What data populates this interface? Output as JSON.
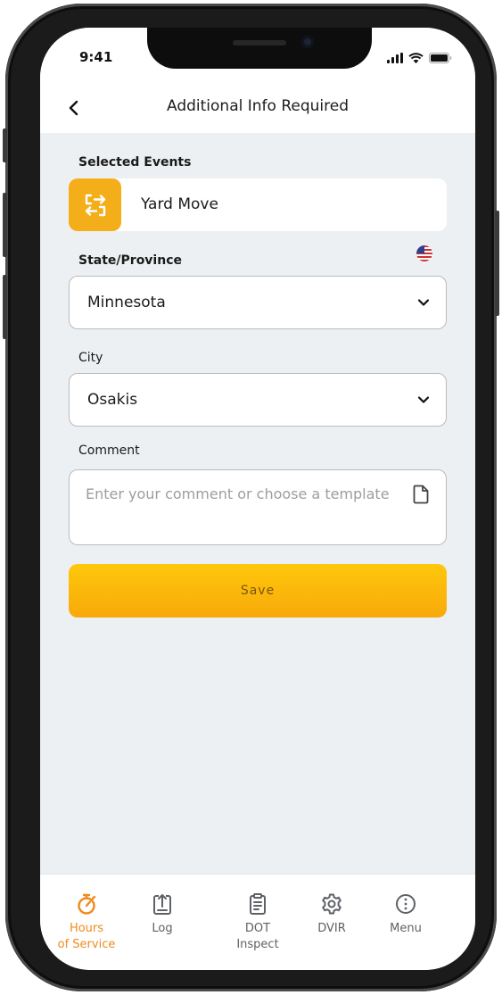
{
  "status_bar": {
    "time": "9:41"
  },
  "header": {
    "title": "Additional Info Required"
  },
  "form": {
    "selected_events_label": "Selected Events",
    "event_name": "Yard Move",
    "state_label": "State/Province",
    "state_value": "Minnesota",
    "city_label": "City",
    "city_value": "Osakis",
    "comment_label": "Comment",
    "comment_placeholder": "Enter your comment or choose a template",
    "comment_value": "",
    "save_label": "Save"
  },
  "tabbar": {
    "items": [
      {
        "label_line1": "Hours",
        "label_line2": "of Service",
        "icon": "stopwatch-icon",
        "active": true
      },
      {
        "label_line1": "Log",
        "label_line2": "",
        "icon": "upload-log-icon",
        "active": false
      },
      {
        "label_line1": "DOT",
        "label_line2": "Inspect",
        "icon": "clipboard-icon",
        "active": false
      },
      {
        "label_line1": "DVIR",
        "label_line2": "",
        "icon": "gear-icon",
        "active": false
      },
      {
        "label_line1": "Menu",
        "label_line2": "",
        "icon": "more-circle-icon",
        "active": false
      }
    ]
  },
  "colors": {
    "accent": "#F3AE1A",
    "active_tab": "#F08A1C",
    "background": "#EDF0F2"
  }
}
